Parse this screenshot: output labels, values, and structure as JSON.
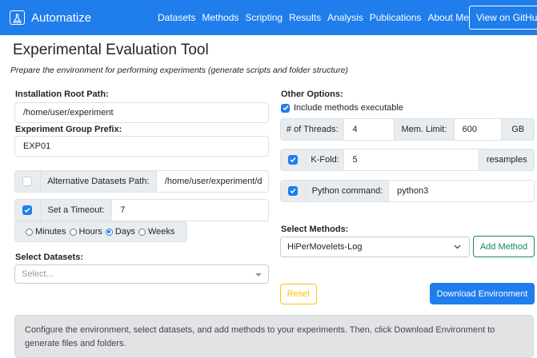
{
  "navbar": {
    "brand": "Automatize",
    "links": [
      "Datasets",
      "Methods",
      "Scripting",
      "Results",
      "Analysis",
      "Publications",
      "About Me"
    ],
    "github": "View on GitHub"
  },
  "page": {
    "title": "Experimental Evaluation Tool",
    "subtitle": "Prepare the environment for performing experiments (generate scripts and folder structure)"
  },
  "left": {
    "root_label": "Installation Root Path:",
    "root_value": "/home/user/experiment",
    "prefix_label": "Experiment Group Prefix:",
    "prefix_value": "EXP01",
    "alt_label": "Alternative Datasets Path:",
    "alt_value": "/home/user/experiment/d",
    "alt_checked": false,
    "timeout_label": "Set a Timeout:",
    "timeout_value": "7",
    "timeout_checked": true,
    "units": [
      "Minutes",
      "Hours",
      "Days",
      "Weeks"
    ],
    "unit_selected": "Days",
    "datasets_label": "Select Datasets:",
    "datasets_placeholder": "Select..."
  },
  "right": {
    "options_label": "Other Options:",
    "include_label": "Include methods executable",
    "include_checked": true,
    "threads_label": "# of Threads:",
    "threads_value": "4",
    "mem_label": "Mem. Limit:",
    "mem_value": "600",
    "mem_unit": "GB",
    "kfold_label": "K-Fold:",
    "kfold_value": "5",
    "kfold_unit": "resamples",
    "kfold_checked": true,
    "python_label": "Python command:",
    "python_value": "python3",
    "python_checked": true,
    "methods_label": "Select Methods:",
    "method_selected": "HiPerMovelets-Log",
    "add_method": "Add Method",
    "reset": "Reset",
    "download": "Download Environment"
  },
  "alert": "Configure the environment, select datasets, and add methods to your experiments. Then, click Download Environment to generate files and folders.",
  "colors": {
    "primary": "#1f7dec",
    "success": "#198754",
    "warning": "#ffc107",
    "alert_bg": "#e2e3e5"
  }
}
